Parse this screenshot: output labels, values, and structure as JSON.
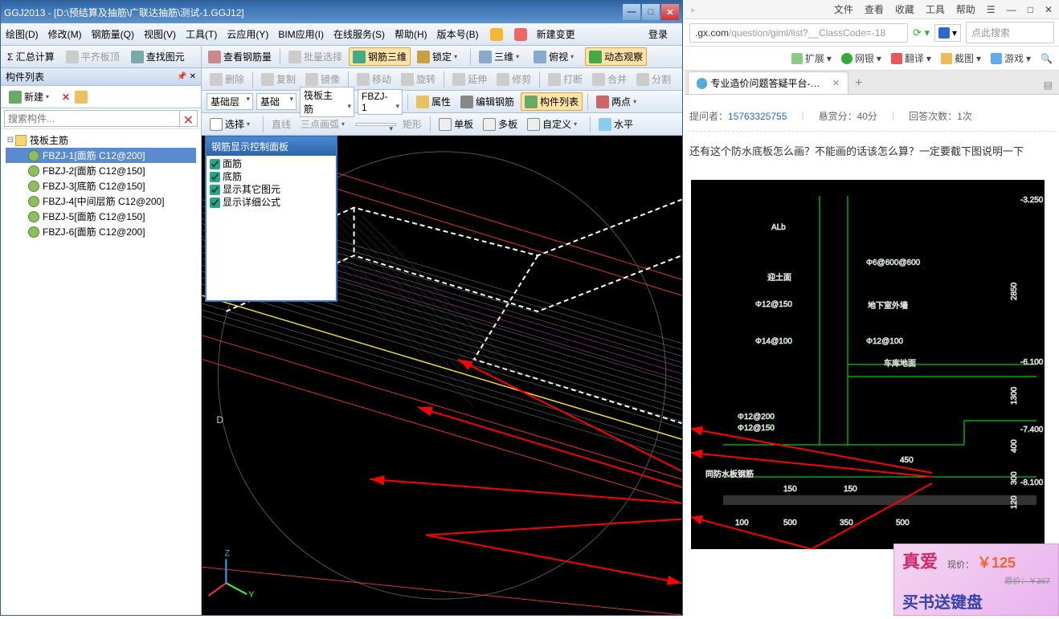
{
  "app": {
    "title": "GGJ2013 - [D:\\预结算及抽筋\\广联达抽筋\\测试-1.GGJ12]",
    "login": "登录",
    "menus": [
      "绘图(D)",
      "修改(M)",
      "钢筋量(Q)",
      "视图(V)",
      "工具(T)",
      "云应用(Y)",
      "BIM应用(I)",
      "在线服务(S)",
      "帮助(H)",
      "版本号(B)"
    ],
    "menu_extra": "新建变更",
    "tb1": {
      "sigma": "Σ 汇总计算",
      "flat": "平齐板顶",
      "find_ge": "查找图元",
      "view_rebar": "查看钢筋量",
      "batch_sel": "批量选择",
      "rebar_3d": "钢筋三维",
      "lock": "锁定",
      "view3d": "三维",
      "top_view": "俯视",
      "dyn_obs": "动态观察"
    },
    "tb_right1": {
      "delete": "删除",
      "copy": "复制",
      "mirror": "镜像",
      "move": "移动",
      "rotate": "旋转",
      "extend": "延伸",
      "trim": "修剪",
      "break": "打断",
      "merge": "合并",
      "split": "分割"
    },
    "tb_right2": {
      "sel1": "基础层",
      "sel2": "基础",
      "sel3": "筏板主筋",
      "sel4": "FBZJ-1",
      "props": "属性",
      "edit_rebar": "编辑钢筋",
      "comp_list": "构件列表",
      "two_pt": "两点"
    },
    "tb_right3": {
      "select": "选择",
      "line": "直线",
      "three_arc": "三点画弧",
      "rect": "矩形",
      "single": "单板",
      "multi": "多板",
      "custom": "自定义",
      "horiz": "水平"
    },
    "left_panel": {
      "title": "构件列表",
      "new": "新建",
      "search_ph": "搜索构件...",
      "root": "筏板主筋",
      "items": [
        "FBZJ-1[面筋 C12@200]",
        "FBZJ-2[面筋 C12@150]",
        "FBZJ-3[底筋 C12@150]",
        "FBZJ-4[中间层筋 C12@200]",
        "FBZJ-5[面筋 C12@150]",
        "FBZJ-6[面筋 C12@200]"
      ]
    },
    "float": {
      "title": "钢筋显示控制面板",
      "cb": [
        "面筋",
        "底筋",
        "显示其它图元",
        "显示详细公式"
      ]
    }
  },
  "browser": {
    "topmenu": [
      "文件",
      "查看",
      "收藏",
      "工具",
      "帮助"
    ],
    "url_pre": ".gx.com",
    "url_rest": "/question/giml/list?__ClassCode=-18",
    "search_ph": "点此搜索",
    "toolbar": [
      "扩展",
      "网银",
      "翻译",
      "截图",
      "游戏"
    ],
    "tab": {
      "title": "专业造价问题答疑平台-广联达!"
    },
    "meta": {
      "asker_label": "提问者：",
      "asker": "15763325755",
      "bounty_label": "悬赏分：",
      "bounty": "40分",
      "answers_label": "回答次数：",
      "answers": "1次"
    },
    "question": "还有这个防水底板怎么画？不能画的话该怎么算？一定要截下图说明一下",
    "ad": {
      "logo": "真爱",
      "now_lbl": "现价：",
      "now": "￥125",
      "orig_lbl": "原价：",
      "orig": "￥367",
      "slogan": "买书送键盘"
    },
    "cad_labels": {
      "alb": "ALb",
      "soil": "迎土面",
      "r600": "Φ6@600@600",
      "l12_150": "Φ12@150",
      "wall": "地下室外墙",
      "l14_100": "Φ14@100",
      "r12_100": "Φ12@100",
      "floor": "车库地面",
      "l12_200": "Φ12@200",
      "l12_150b": "Φ12@150",
      "wp": "同防水板钢筋",
      "d150a": "150",
      "d150b": "150",
      "d450": "450",
      "d100": "100",
      "d500a": "500",
      "d350": "350",
      "d500b": "500",
      "h2850": "2850",
      "h1300": "1300",
      "h400": "400",
      "h300": "300",
      "h120": "120",
      "el3250": "-3.250",
      "el6100": "-6.100",
      "el7400": "-7.400",
      "el8100": "-8.100"
    }
  }
}
